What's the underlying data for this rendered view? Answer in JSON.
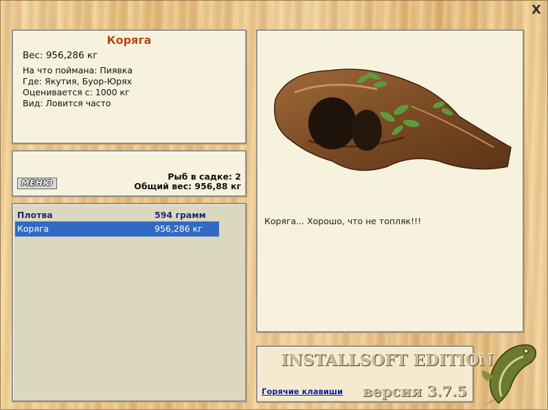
{
  "window": {
    "close_label": "X"
  },
  "info": {
    "title": "Коряга",
    "weight": "Вес: 956,286 кг",
    "details": [
      "На что поймана: Пиявка",
      "Где: Якутия, Буор-Юрях",
      "Оценивается с: 1000 кг",
      "Вид: Ловится часто"
    ]
  },
  "stats": {
    "menu_label": "МЕНЮ",
    "fish_in_keepnet": "Рыб в садке: 2",
    "total_weight": "Общий вес: 956,88 кг"
  },
  "catch_list": {
    "header": {
      "name": "Плотва",
      "weight": "594 грамм"
    },
    "rows": [
      {
        "name": "Коряга",
        "weight": "956,286 кг",
        "selected": true
      }
    ]
  },
  "image_panel": {
    "image_icon": "driftwood-snag-image",
    "description": "Коряга... Хорошо, что не топляк!!!"
  },
  "brand": {
    "edition": "INSTALLSOFT EDITION",
    "hotkeys_link": "Горячие клавиши",
    "version": "версия 3.7.5",
    "logo_icon": "pike-fish-logo"
  },
  "colors": {
    "title_red": "#b8461a",
    "selection_blue": "#316ac5",
    "link_blue": "#0f1f9c",
    "panel_bg": "#f7f2dd"
  }
}
